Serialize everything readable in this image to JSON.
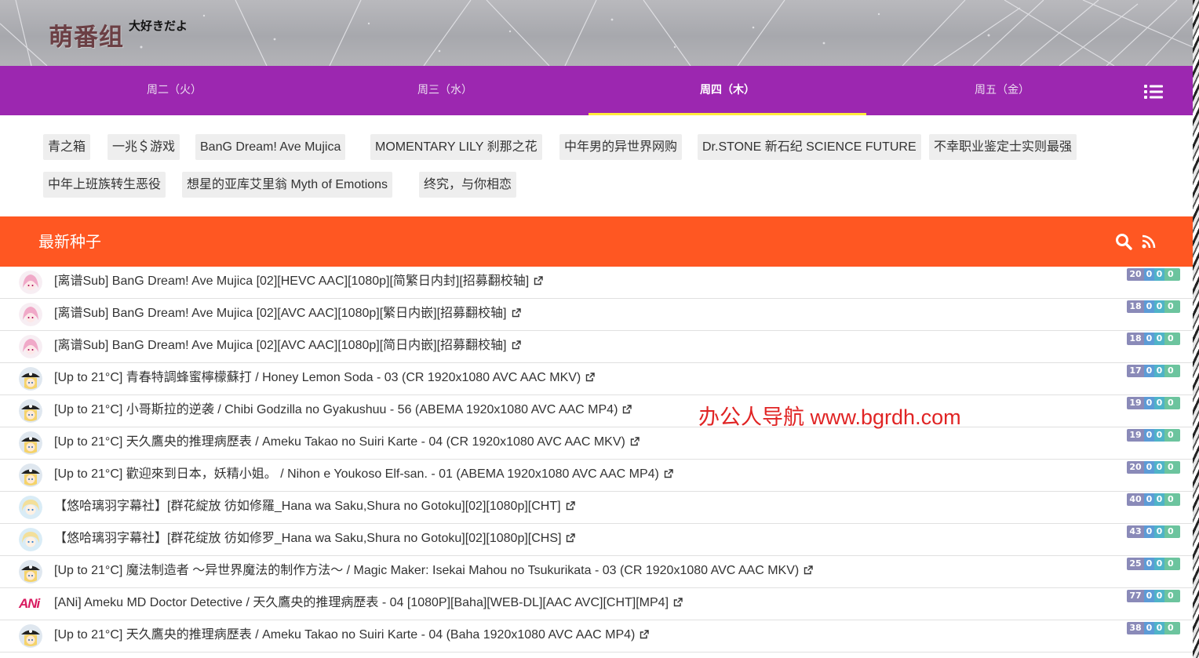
{
  "header": {
    "logo": "萌番组",
    "tagline": "大好きだよ"
  },
  "weekdays": [
    {
      "label": "周二（火）",
      "active": false
    },
    {
      "label": "周三（水）",
      "active": false
    },
    {
      "label": "周四（木）",
      "active": true
    },
    {
      "label": "周五（金）",
      "active": false
    }
  ],
  "nav_icon": "list-icon",
  "bangumi_tags": [
    "青之箱",
    "一兆＄游戏",
    "BanG Dream! Ave Mujica",
    "MOMENTARY LILY 刹那之花",
    "中年男的异世界网购",
    "Dr.STONE 新石纪 SCIENCE FUTURE",
    "不幸职业鉴定士实则最强",
    "中年上班族转生恶役",
    "想星的亚库艾里翁 Myth of Emotions",
    "终究，与你相恋"
  ],
  "torrents_bar": {
    "title": "最新种子",
    "icons": [
      "search-icon",
      "rss-icon"
    ]
  },
  "torrents": [
    {
      "avatar": "pink-hair-avatar",
      "title": "[离谱Sub] BanG Dream! Ave Mujica [02][HEVC AAC][1080p][简繁日内封][招募翻校轴]",
      "badges": [
        "20",
        "0",
        "0",
        "0"
      ]
    },
    {
      "avatar": "pink-hair-avatar",
      "title": "[离谱Sub] BanG Dream! Ave Mujica [02][AVC AAC][1080p][繁日内嵌][招募翻校轴]",
      "badges": [
        "18",
        "0",
        "0",
        "0"
      ]
    },
    {
      "avatar": "pink-hair-avatar",
      "title": "[离谱Sub] BanG Dream! Ave Mujica [02][AVC AAC][1080p][简日内嵌][招募翻校轴]",
      "badges": [
        "18",
        "0",
        "0",
        "0"
      ]
    },
    {
      "avatar": "pirate-hat-avatar",
      "title": "[Up to 21°C] 青春特調蜂蜜檸檬蘇打 / Honey Lemon Soda - 03 (CR 1920x1080 AVC AAC MKV)",
      "badges": [
        "17",
        "0",
        "0",
        "0"
      ]
    },
    {
      "avatar": "pirate-hat-avatar",
      "title": "[Up to 21°C] 小哥斯拉的逆袭 / Chibi Godzilla no Gyakushuu - 56 (ABEMA 1920x1080 AVC AAC MP4)",
      "badges": [
        "19",
        "0",
        "0",
        "0"
      ]
    },
    {
      "avatar": "pirate-hat-avatar",
      "title": "[Up to 21°C] 天久鷹央的推理病歷表 / Ameku Takao no Suiri Karte - 04 (CR 1920x1080 AVC AAC MKV)",
      "badges": [
        "19",
        "0",
        "0",
        "0"
      ]
    },
    {
      "avatar": "pirate-hat-avatar",
      "title": "[Up to 21°C] 歡迎來到日本，妖精小姐。 / Nihon e Youkoso Elf-san. - 01 (ABEMA 1920x1080 AVC AAC MP4)",
      "badges": [
        "20",
        "0",
        "0",
        "0"
      ]
    },
    {
      "avatar": "blonde-avatar",
      "title": "【悠哈璃羽字幕社】[群花綻放 彷如修羅_Hana wa Saku,Shura no Gotoku][02][1080p][CHT]",
      "badges": [
        "40",
        "0",
        "0",
        "0"
      ]
    },
    {
      "avatar": "blonde-avatar",
      "title": "【悠哈璃羽字幕社】[群花绽放 彷如修罗_Hana wa Saku,Shura no Gotoku][02][1080p][CHS]",
      "badges": [
        "43",
        "0",
        "0",
        "0"
      ]
    },
    {
      "avatar": "pirate-hat-avatar",
      "title": "[Up to 21°C] 魔法制造者 ～异世界魔法的制作方法～ / Magic Maker: Isekai Mahou no Tsukurikata - 03 (CR 1920x1080 AVC AAC MKV)",
      "badges": [
        "25",
        "0",
        "0",
        "0"
      ]
    },
    {
      "avatar": "ani-logo",
      "avatar_text": "ANi",
      "title": "[ANi] Ameku MD Doctor Detective / 天久鷹央的推理病歷表 - 04 [1080P][Baha][WEB-DL][AAC AVC][CHT][MP4]",
      "badges": [
        "77",
        "0",
        "0",
        "0"
      ]
    },
    {
      "avatar": "pirate-hat-avatar",
      "title": "[Up to 21°C] 天久鷹央的推理病歷表 / Ameku Takao no Suiri Karte - 04 (Baha 1920x1080 AVC AAC MP4)",
      "badges": [
        "38",
        "0",
        "0",
        "0"
      ]
    }
  ],
  "watermark": "办公人导航 www.bgrdh.com",
  "colors": {
    "nav": "#9c27b0",
    "torrent_bar": "#ff5722",
    "active_underline": "#ffeb3b"
  }
}
